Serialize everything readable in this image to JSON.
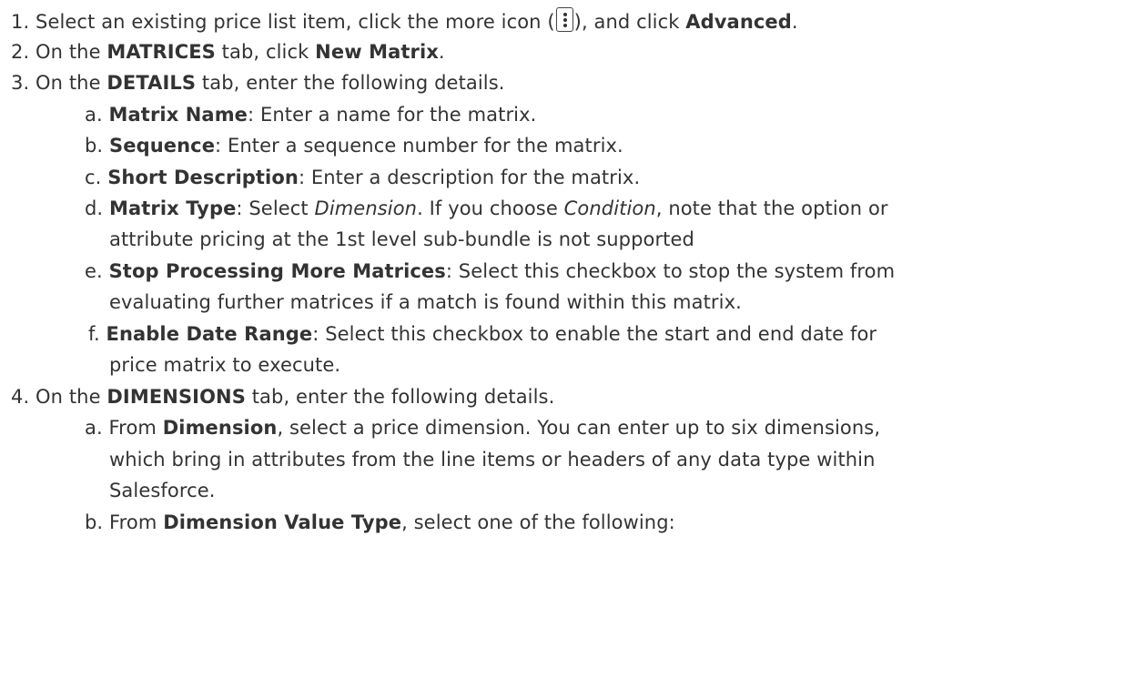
{
  "steps": [
    {
      "num": "1.",
      "pre": "Select an existing price list item, click the more icon (",
      "icon": "more-vertical-icon",
      "mid": "), and click ",
      "b1": "Advanced",
      "post": "."
    },
    {
      "num": "2.",
      "pre": "On the ",
      "b1": "MATRICES",
      "mid": " tab, click ",
      "b2": "New Matrix",
      "post": "."
    },
    {
      "num": "3.",
      "pre": "On the ",
      "b1": "DETAILS",
      "post": " tab, enter the following details."
    },
    {
      "num": "4.",
      "pre": "On the ",
      "b1": "DIMENSIONS",
      "post": " tab, enter the following details."
    }
  ],
  "details": {
    "a": {
      "letter": "a.",
      "term": "Matrix Name",
      "text": ": Enter a name for the matrix."
    },
    "b": {
      "letter": "b.",
      "term": "Sequence",
      "text": ": Enter a sequence number for the matrix."
    },
    "c": {
      "letter": "c.",
      "term": "Short Description",
      "text": ": Enter a description for the matrix."
    },
    "d": {
      "letter": "d.",
      "term": "Matrix Type",
      "t1": ": Select ",
      "i1": "Dimension",
      "t2": ". If you choose ",
      "i2": "Condition",
      "t3": ", note that the option or",
      "line2": "attribute pricing at the 1st level sub-bundle is not supported"
    },
    "e": {
      "letter": "e.",
      "term": "Stop Processing More Matrices",
      "text": ": Select this checkbox to stop the system from",
      "line2": "evaluating further matrices if a match is found within this matrix."
    },
    "f": {
      "letter": "f.",
      "term": "Enable Date Range",
      "text": ": Select this checkbox to enable the start and end date for",
      "line2": "price matrix to execute."
    }
  },
  "dimensions": {
    "a": {
      "letter": "a.",
      "pre": "From ",
      "term": "Dimension",
      "text": ", select a price dimension. You can enter up to six dimensions,",
      "line2": "which bring in attributes from the line items or headers of any data type within",
      "line3": "Salesforce."
    },
    "b": {
      "letter": "b.",
      "pre": "From ",
      "term": "Dimension Value Type",
      "text": ", select one of the following:"
    }
  }
}
